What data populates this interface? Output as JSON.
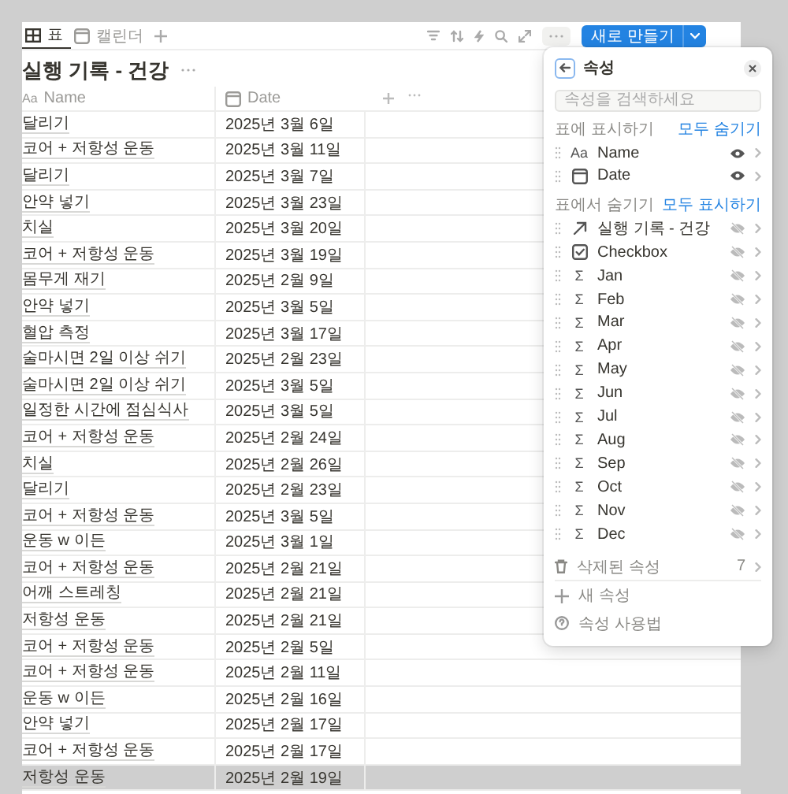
{
  "view_tabs": [
    {
      "label": "표",
      "kind": "table",
      "selected": true
    },
    {
      "label": "캘린더",
      "kind": "calendar",
      "selected": false
    }
  ],
  "toolbar": {
    "new_button": "새로 만들기"
  },
  "page_title": "실행 기록 - 건강",
  "table": {
    "columns": [
      {
        "label": "Name",
        "kind": "text",
        "icon": "Aa"
      },
      {
        "label": "Date",
        "kind": "date"
      }
    ],
    "rows": [
      {
        "name": "달리기",
        "date": "2025년 3월 6일",
        "selected": false
      },
      {
        "name": "코어 + 저항성 운동",
        "date": "2025년 3월 11일",
        "selected": false
      },
      {
        "name": "달리기",
        "date": "2025년 3월 7일",
        "selected": false
      },
      {
        "name": "안약 넣기",
        "date": "2025년 3월 23일",
        "selected": false
      },
      {
        "name": "치실",
        "date": "2025년 3월 20일",
        "selected": false
      },
      {
        "name": "코어 + 저항성 운동",
        "date": "2025년 3월 19일",
        "selected": false
      },
      {
        "name": "몸무게 재기",
        "date": "2025년 2월 9일",
        "selected": false
      },
      {
        "name": "안약 넣기",
        "date": "2025년 3월 5일",
        "selected": false
      },
      {
        "name": "혈압 측정",
        "date": "2025년 3월 17일",
        "selected": false
      },
      {
        "name": "술마시면 2일 이상 쉬기",
        "date": "2025년 2월 23일",
        "selected": false
      },
      {
        "name": "술마시면 2일 이상 쉬기",
        "date": "2025년 3월 5일",
        "selected": false
      },
      {
        "name": "일정한 시간에 점심식사",
        "date": "2025년 3월 5일",
        "selected": false
      },
      {
        "name": "코어 + 저항성 운동",
        "date": "2025년 2월 24일",
        "selected": false
      },
      {
        "name": "치실",
        "date": "2025년 2월 26일",
        "selected": false
      },
      {
        "name": "달리기",
        "date": "2025년 2월 23일",
        "selected": false
      },
      {
        "name": "코어 + 저항성 운동",
        "date": "2025년 3월 5일",
        "selected": false
      },
      {
        "name": "운동 w 이든",
        "date": "2025년 3월 1일",
        "selected": false
      },
      {
        "name": "코어 + 저항성 운동",
        "date": "2025년 2월 21일",
        "selected": false
      },
      {
        "name": "어깨 스트레칭",
        "date": "2025년 2월 21일",
        "selected": false
      },
      {
        "name": "저항성 운동",
        "date": "2025년 2월 21일",
        "selected": false
      },
      {
        "name": "코어 + 저항성 운동",
        "date": "2025년 2월 5일",
        "selected": false
      },
      {
        "name": "코어 + 저항성 운동",
        "date": "2025년 2월 11일",
        "selected": false
      },
      {
        "name": "운동 w 이든",
        "date": "2025년 2월 16일",
        "selected": false
      },
      {
        "name": "안약 넣기",
        "date": "2025년 2월 17일",
        "selected": false
      },
      {
        "name": "코어 + 저항성 운동",
        "date": "2025년 2월 17일",
        "selected": false
      },
      {
        "name": "저항성 운동",
        "date": "2025년 2월 19일",
        "selected": true
      }
    ]
  },
  "properties_panel": {
    "title": "속성",
    "search": {
      "placeholder": "속성을 검색하세요"
    },
    "sections": [
      {
        "label": "표에 표시하기",
        "action": "모두 숨기기",
        "items": [
          {
            "label": "Name",
            "kind": "text",
            "icon": "Aa",
            "visible": true
          },
          {
            "label": "Date",
            "kind": "date",
            "visible": true
          }
        ]
      },
      {
        "label": "표에서 숨기기",
        "action": "모두 표시하기",
        "items": [
          {
            "label": "실행 기록 - 건강",
            "kind": "relation",
            "visible": false
          },
          {
            "label": "Checkbox",
            "kind": "checkbox",
            "visible": false
          },
          {
            "label": "Jan",
            "kind": "formula",
            "icon": "Σ",
            "visible": false
          },
          {
            "label": "Feb",
            "kind": "formula",
            "icon": "Σ",
            "visible": false
          },
          {
            "label": "Mar",
            "kind": "formula",
            "icon": "Σ",
            "visible": false
          },
          {
            "label": "Apr",
            "kind": "formula",
            "icon": "Σ",
            "visible": false
          },
          {
            "label": "May",
            "kind": "formula",
            "icon": "Σ",
            "visible": false
          },
          {
            "label": "Jun",
            "kind": "formula",
            "icon": "Σ",
            "visible": false
          },
          {
            "label": "Jul",
            "kind": "formula",
            "icon": "Σ",
            "visible": false
          },
          {
            "label": "Aug",
            "kind": "formula",
            "icon": "Σ",
            "visible": false
          },
          {
            "label": "Sep",
            "kind": "formula",
            "icon": "Σ",
            "visible": false
          },
          {
            "label": "Oct",
            "kind": "formula",
            "icon": "Σ",
            "visible": false
          },
          {
            "label": "Nov",
            "kind": "formula",
            "icon": "Σ",
            "visible": false
          },
          {
            "label": "Dec",
            "kind": "formula",
            "icon": "Σ",
            "visible": false
          }
        ]
      }
    ],
    "deleted": {
      "label": "삭제된 속성",
      "count": "7"
    },
    "footer": [
      {
        "label": "새 속성",
        "kind": "add"
      },
      {
        "label": "속성 사용법",
        "kind": "help"
      }
    ]
  }
}
